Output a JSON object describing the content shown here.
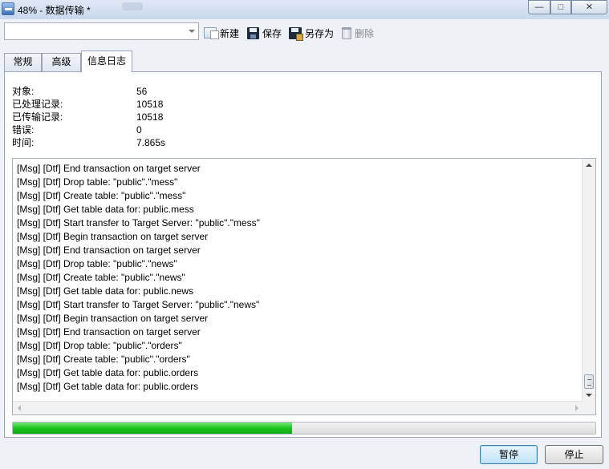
{
  "window": {
    "title": "48% - 数据传输 *",
    "minimize": "—",
    "maximize": "□",
    "close": "✕"
  },
  "toolbar": {
    "profile_value": "",
    "new_label": "新建",
    "save_label": "保存",
    "saveas_label": "另存为",
    "delete_label": "删除"
  },
  "tabs": [
    {
      "label": "常规"
    },
    {
      "label": "高级"
    },
    {
      "label": "信息日志"
    }
  ],
  "stats": {
    "objects": {
      "label": "对象:",
      "value": "56"
    },
    "processed": {
      "label": "已处理记录:",
      "value": "10518"
    },
    "transferred": {
      "label": "已传输记录:",
      "value": "10518"
    },
    "errors": {
      "label": "错误:",
      "value": "0"
    },
    "time": {
      "label": "时间:",
      "value": "7.865s"
    }
  },
  "log": [
    "[Msg] [Dtf] End transaction on target server",
    "[Msg] [Dtf] Drop table: \"public\".\"mess\"",
    "[Msg] [Dtf] Create table: \"public\".\"mess\"",
    "[Msg] [Dtf] Get table data for: public.mess",
    "[Msg] [Dtf] Start transfer to Target Server: \"public\".\"mess\"",
    "[Msg] [Dtf] Begin transaction on target server",
    "[Msg] [Dtf] End transaction on target server",
    "[Msg] [Dtf] Drop table: \"public\".\"news\"",
    "[Msg] [Dtf] Create table: \"public\".\"news\"",
    "[Msg] [Dtf] Get table data for: public.news",
    "[Msg] [Dtf] Start transfer to Target Server: \"public\".\"news\"",
    "[Msg] [Dtf] Begin transaction on target server",
    "[Msg] [Dtf] End transaction on target server",
    "[Msg] [Dtf] Drop table: \"public\".\"orders\"",
    "[Msg] [Dtf] Create table: \"public\".\"orders\"",
    "[Msg] [Dtf] Get table data for: public.orders",
    "[Msg] [Dtf] Get table data for: public.orders"
  ],
  "progress": {
    "percent": 48,
    "color": "#1bc41e"
  },
  "buttons": {
    "pause_label": "暂停",
    "stop_label": "停止"
  },
  "icons": {
    "app": "transfer-app-icon",
    "new": "new-profile-icon",
    "save": "floppy-disk-icon",
    "saveas": "floppy-saveas-icon",
    "delete": "trash-icon"
  }
}
